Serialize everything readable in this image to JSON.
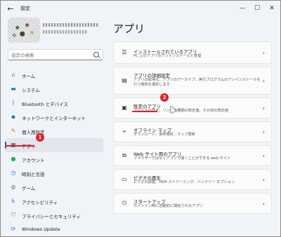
{
  "window": {
    "title": "設定"
  },
  "search": {
    "placeholder": "設定の検索"
  },
  "nav": [
    {
      "label": "ホーム",
      "icon": "home-icon"
    },
    {
      "label": "システム",
      "icon": "system-icon"
    },
    {
      "label": "Bluetooth とデバイス",
      "icon": "bluetooth-icon"
    },
    {
      "label": "ネットワークとインターネット",
      "icon": "network-icon"
    },
    {
      "label": "個人用設定",
      "icon": "brush-icon"
    },
    {
      "label": "アプリ",
      "icon": "apps-icon",
      "selected": true
    },
    {
      "label": "アカウント",
      "icon": "account-icon"
    },
    {
      "label": "時刻と言語",
      "icon": "clock-icon"
    },
    {
      "label": "ゲーム",
      "icon": "game-icon"
    },
    {
      "label": "アクセシビリティ",
      "icon": "accessibility-icon"
    },
    {
      "label": "プライバシーとセキュリティ",
      "icon": "shield-icon"
    },
    {
      "label": "Windows Update",
      "icon": "update-icon"
    }
  ],
  "main": {
    "title": "アプリ",
    "cards": [
      {
        "title": "インストールされているアプリ",
        "desc": "PC 上のアプリのアンインストールと管理",
        "icon": "list-icon"
      },
      {
        "title": "アプリの詳細設定",
        "desc": "アプリの取得元、アプリのアーカイブ、実行プログラムのアンインストールを行う場所を選択します",
        "icon": "app-settings-icon"
      },
      {
        "title": "既定のアプリ",
        "desc": "ファイルの既定、リンクの種類の既定値、その他の既定値",
        "icon": "default-apps-icon"
      },
      {
        "title": "オフライン マップ",
        "desc": "ダウンロード、保存場所、マップ更新",
        "icon": "map-icon"
      },
      {
        "title": "Web サイト用のアプリ",
        "desc": "ブラウザーではなくアプリで開くことができる web サイト",
        "icon": "web-app-icon"
      },
      {
        "title": "ビデオの再生",
        "desc": "ビデオの調整、HDR ストリーミング、バッテリー オプション",
        "icon": "video-icon"
      },
      {
        "title": "スタートアップ",
        "desc": "サインイン時に自動的に開始されるアプリ",
        "icon": "startup-icon"
      }
    ]
  },
  "annotations": {
    "badge1": "1",
    "badge2": "2"
  },
  "colors": {
    "accent": "#0067c0",
    "annotation": "#e0202c"
  }
}
